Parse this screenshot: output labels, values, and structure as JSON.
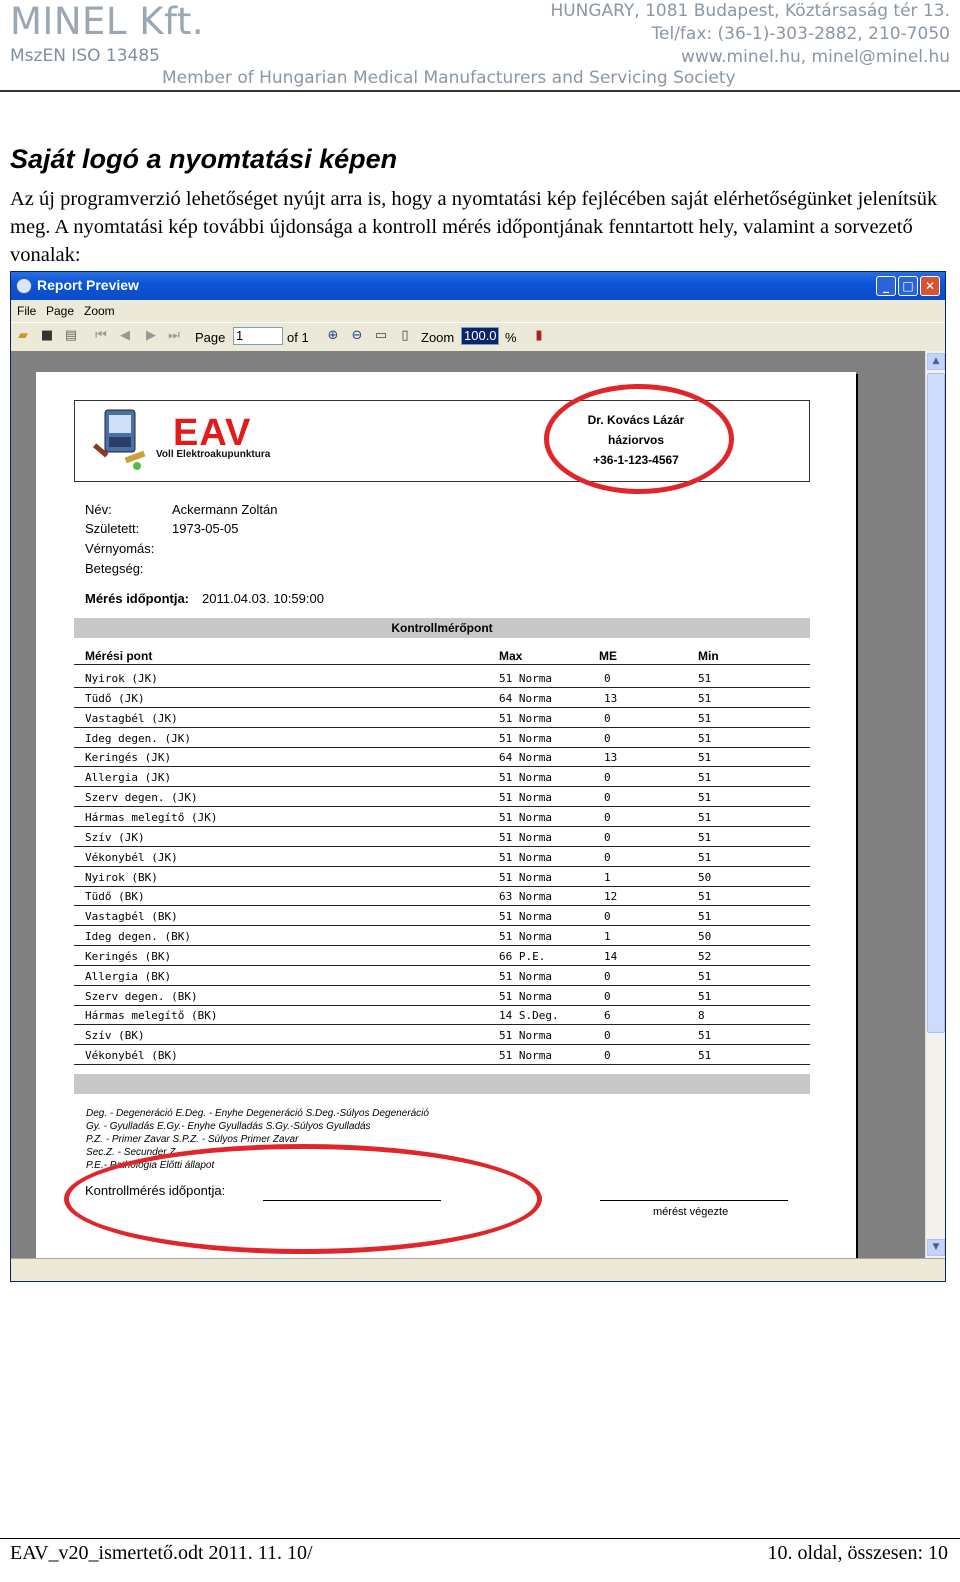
{
  "letterhead": {
    "company": "MINEL Kft.",
    "iso": "MszEN ISO 13485",
    "address": "HUNGARY, 1081 Budapest, Köztársaság tér 13.",
    "phone": "Tel/fax: (36-1)-303-2882, 210-7050",
    "web": "www.minel.hu, minel@minel.hu",
    "member": "Member of Hungarian Medical Manufacturers and Servicing Society"
  },
  "section": {
    "heading": "Saját logó a nyomtatási képen",
    "paragraph": "Az új programverzió lehetőséget nyújt arra is, hogy a nyomtatási kép fejlécében saját elérhetőségünket jelenítsük meg. A nyomtatási kép további újdonsága a kontroll mérés időpontjának fenntartott hely, valamint a sorvezető vonalak:"
  },
  "window": {
    "title": "Report Preview",
    "menu": [
      "File",
      "Page",
      "Zoom"
    ],
    "toolbar": {
      "page_label": "Page",
      "page_value": "1",
      "of_label": "of 1",
      "zoom_label": "Zoom",
      "zoom_value": "100.0",
      "percent": "%"
    }
  },
  "report": {
    "logo_text": "EAV",
    "logo_subtitle": "Voll Elektroakupunktura",
    "doctor": {
      "name": "Dr. Kovács Lázár",
      "title": "háziorvos",
      "phone": "+36-1-123-4567"
    },
    "patient": {
      "name_label": "Név:",
      "name_value": "Ackermann Zoltán",
      "born_label": "Született:",
      "born_value": "1973-05-05",
      "bp_label": "Vérnyomás:",
      "disease_label": "Betegség:",
      "meas_label": "Mérés időpontja:",
      "meas_value": "2011.04.03. 10:59:00"
    },
    "section_title": "Kontrollmérőpont",
    "columns": {
      "point": "Mérési pont",
      "max": "Max",
      "me": "ME",
      "min": "Min"
    },
    "rows": [
      {
        "point": "Nyirok (JK)",
        "max": "51 Norma",
        "me": "0",
        "min": "51"
      },
      {
        "point": "Tüdő (JK)",
        "max": "64 Norma",
        "me": "13",
        "min": "51"
      },
      {
        "point": "Vastagbél (JK)",
        "max": "51 Norma",
        "me": "0",
        "min": "51"
      },
      {
        "point": "Ideg degen. (JK)",
        "max": "51 Norma",
        "me": "0",
        "min": "51"
      },
      {
        "point": "Keringés (JK)",
        "max": "64 Norma",
        "me": "13",
        "min": "51"
      },
      {
        "point": "Allergia (JK)",
        "max": "51 Norma",
        "me": "0",
        "min": "51"
      },
      {
        "point": "Szerv degen. (JK)",
        "max": "51 Norma",
        "me": "0",
        "min": "51"
      },
      {
        "point": "Hármas melegítő (JK)",
        "max": "51 Norma",
        "me": "0",
        "min": "51"
      },
      {
        "point": "Szív (JK)",
        "max": "51 Norma",
        "me": "0",
        "min": "51"
      },
      {
        "point": "Vékonybél (JK)",
        "max": "51 Norma",
        "me": "0",
        "min": "51"
      },
      {
        "point": "Nyirok (BK)",
        "max": "51 Norma",
        "me": "1",
        "min": "50"
      },
      {
        "point": "Tüdő (BK)",
        "max": "63 Norma",
        "me": "12",
        "min": "51"
      },
      {
        "point": "Vastagbél (BK)",
        "max": "51 Norma",
        "me": "0",
        "min": "51"
      },
      {
        "point": "Ideg degen. (BK)",
        "max": "51 Norma",
        "me": "1",
        "min": "50"
      },
      {
        "point": "Keringés (BK)",
        "max": "66 P.E.",
        "me": "14",
        "min": "52"
      },
      {
        "point": "Allergia (BK)",
        "max": "51 Norma",
        "me": "0",
        "min": "51"
      },
      {
        "point": "Szerv degen. (BK)",
        "max": "51 Norma",
        "me": "0",
        "min": "51"
      },
      {
        "point": "Hármas melegítő (BK)",
        "max": "14 S.Deg.",
        "me": "6",
        "min": "8"
      },
      {
        "point": "Szív (BK)",
        "max": "51 Norma",
        "me": "0",
        "min": "51"
      },
      {
        "point": "Vékonybél (BK)",
        "max": "51 Norma",
        "me": "0",
        "min": "51"
      }
    ],
    "legend": [
      "Deg. - Degeneráció   E.Deg. - Enyhe Degeneráció   S.Deg.-Súlyos Degeneráció",
      "Gy. - Gyulladás  E.Gy.- Enyhe Gyulladás   S.Gy.-Súlyos Gyulladás",
      "P.Z. - Primer Zavar   S.P.Z. - Súlyos Primer Zavar",
      "Sec.Z. - Secunder Z.",
      "P.E.- Pathologia Előtti állapot"
    ],
    "control_label": "Kontrollmérés időpontja:",
    "done_label": "mérést végezte"
  },
  "footer": {
    "left": "EAV_v20_ismertető.odt  2011. 11. 10/",
    "right": "10. oldal, összesen: 10"
  },
  "colors": {
    "accent_red": "#e0262a",
    "xp_blue": "#0a4cc8",
    "letterhead_gray": "#9aa7b4"
  }
}
